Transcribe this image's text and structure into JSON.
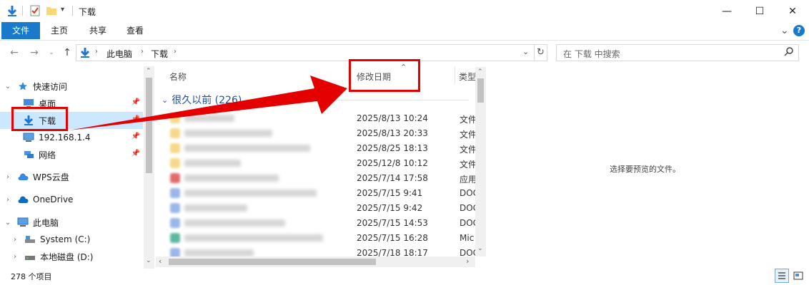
{
  "window": {
    "title": "下载",
    "minimize": "—",
    "maximize": "☐",
    "close": "✕"
  },
  "ribbon": {
    "tabs": [
      "文件",
      "主页",
      "共享",
      "查看"
    ],
    "collapse": "⌄",
    "help": "?"
  },
  "address": {
    "breadcrumb": [
      "此电脑",
      "下载"
    ],
    "search_placeholder": "在 下载 中搜索"
  },
  "navpane": {
    "quick_access": "快速访问",
    "items": [
      {
        "label": "桌面",
        "icon": "desktop-icon"
      },
      {
        "label": "下载",
        "icon": "download-arrow-icon"
      },
      {
        "label": "192.168.1.4",
        "icon": "computer-icon"
      },
      {
        "label": "网络",
        "icon": "network-icon"
      }
    ],
    "wps": "WPS云盘",
    "onedrive": "OneDrive",
    "this_pc": "此电脑",
    "drives": [
      {
        "label": "System (C:)",
        "icon": "drive-c-icon"
      },
      {
        "label": "本地磁盘 (D:)",
        "icon": "drive-d-icon"
      }
    ]
  },
  "filelist": {
    "columns": {
      "name": "名称",
      "date": "修改日期",
      "type": "类型"
    },
    "group_label": "很久以前 (226)",
    "rows": [
      {
        "date": "2025/8/13 10:24",
        "type": "文件",
        "color": "#f5d98a"
      },
      {
        "date": "2025/8/13 20:33",
        "type": "文件",
        "color": "#f5d98a"
      },
      {
        "date": "2025/8/25 18:13",
        "type": "文件",
        "color": "#f5d98a"
      },
      {
        "date": "2025/12/8 10:12",
        "type": "文件",
        "color": "#f5d98a"
      },
      {
        "date": "2025/7/14 17:58",
        "type": "应用",
        "color": "#e26b6b"
      },
      {
        "date": "2025/7/15 9:41",
        "type": "DOC",
        "color": "#9bb6e8"
      },
      {
        "date": "2025/7/15 9:42",
        "type": "DOC",
        "color": "#9bb6e8"
      },
      {
        "date": "2025/7/15 14:53",
        "type": "DOC",
        "color": "#9bb6e8"
      },
      {
        "date": "2025/7/15 16:28",
        "type": "Mic",
        "color": "#5cb8a0"
      },
      {
        "date": "2025/7/18 18:17",
        "type": "DOC",
        "color": "#9bb6e8"
      }
    ]
  },
  "preview": {
    "message": "选择要预览的文件。"
  },
  "status": {
    "item_count": "278 个项目"
  },
  "colors": {
    "accent": "#1979ca",
    "selection": "#cce8ff",
    "annotation": "#e50000"
  }
}
